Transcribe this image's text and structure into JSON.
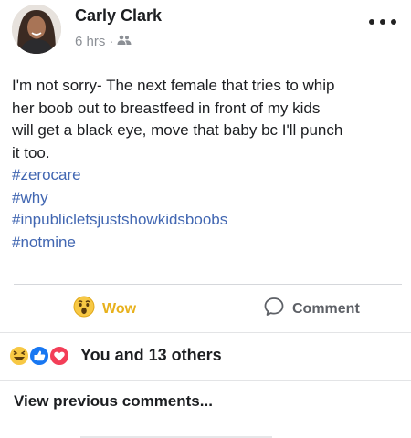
{
  "post": {
    "author": "Carly Clark",
    "time": "6 hrs",
    "separator": "·",
    "audience_icon": "friends-icon",
    "menu_icon": "more-options-icon",
    "body_lines": [
      "I'm not sorry- The next female that tries to whip",
      "her boob out to breastfeed in front of my kids",
      "will get a black eye, move that baby bc I'll punch",
      "it too."
    ],
    "hashtags": [
      "#zerocare",
      "#why",
      "#inpublicletsjustshowkidsboobs",
      "#notmine"
    ]
  },
  "actions": {
    "wow_label": "Wow",
    "wow_icon": "wow-emoji-icon",
    "comment_label": "Comment",
    "comment_icon": "comment-bubble-icon"
  },
  "reactions": {
    "icons": [
      "haha-emoji-icon",
      "like-icon",
      "love-icon"
    ],
    "summary": "You and 13 others"
  },
  "comments": {
    "view_previous": "View previous comments..."
  },
  "colors": {
    "hashtag": "#4267b2",
    "wow": "#e8b11c",
    "like": "#1877f2",
    "love": "#f33e58",
    "meta": "#8b8f95"
  }
}
